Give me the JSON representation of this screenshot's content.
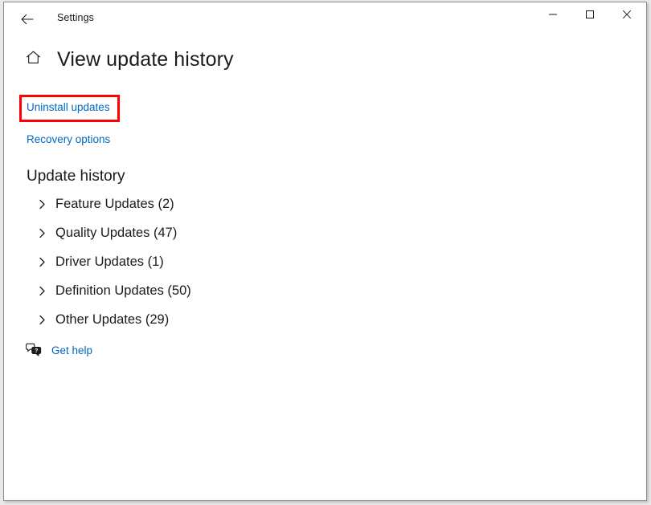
{
  "window": {
    "title": "Settings",
    "back_icon": "back-arrow-icon",
    "controls": {
      "minimize": "minimize-icon",
      "maximize": "maximize-icon",
      "close": "close-icon"
    }
  },
  "page": {
    "home_icon": "home-icon",
    "title": "View update history",
    "links": [
      {
        "label": "Uninstall updates",
        "highlighted": true
      },
      {
        "label": "Recovery options",
        "highlighted": false
      }
    ],
    "section_heading": "Update history",
    "categories": [
      {
        "label": "Feature Updates (2)",
        "name": "feature-updates",
        "count": 2
      },
      {
        "label": "Quality Updates (47)",
        "name": "quality-updates",
        "count": 47
      },
      {
        "label": "Driver Updates (1)",
        "name": "driver-updates",
        "count": 1
      },
      {
        "label": "Definition Updates (50)",
        "name": "definition-updates",
        "count": 50
      },
      {
        "label": "Other Updates (29)",
        "name": "other-updates",
        "count": 29
      }
    ],
    "get_help": {
      "label": "Get help",
      "icon": "help-chat-icon"
    }
  },
  "colors": {
    "link": "#0067c0",
    "highlight_box": "#ff0000",
    "text": "#1b1b1b",
    "window_background": "#ffffff",
    "desktop_background": "#e9e9e9"
  }
}
